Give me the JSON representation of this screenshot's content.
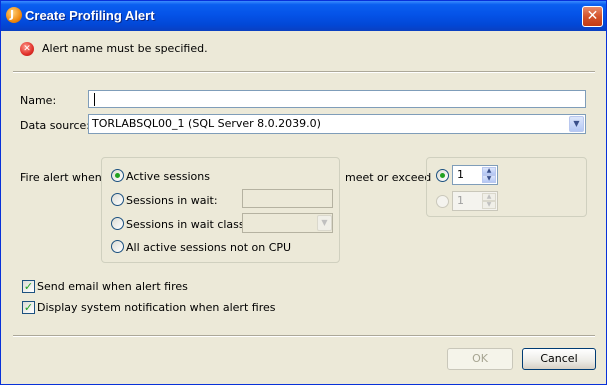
{
  "window": {
    "title": "Create Profiling Alert",
    "close_label": "✕"
  },
  "message": {
    "text": "Alert name must be specified.",
    "icon": "error-icon"
  },
  "name_field": {
    "label": "Name:",
    "value": ""
  },
  "data_source": {
    "label": "Data source:",
    "value": "TORLABSQL00_1 (SQL Server 8.0.2039.0)"
  },
  "fire_alert": {
    "label": "Fire alert when",
    "options": [
      {
        "label": "Active sessions",
        "selected": true
      },
      {
        "label": "Sessions in wait:",
        "selected": false
      },
      {
        "label": "Sessions in wait class:",
        "selected": false
      },
      {
        "label": "All active sessions not on CPU",
        "selected": false
      }
    ]
  },
  "threshold": {
    "label": "meet or exceed",
    "spinner1_value": "1",
    "spinner2_value": "1"
  },
  "options": {
    "send_email": {
      "label": "Send email when alert fires",
      "checked": true
    },
    "system_notification": {
      "label": "Display system notification when alert fires",
      "checked": true
    }
  },
  "buttons": {
    "ok": "OK",
    "cancel": "Cancel"
  }
}
